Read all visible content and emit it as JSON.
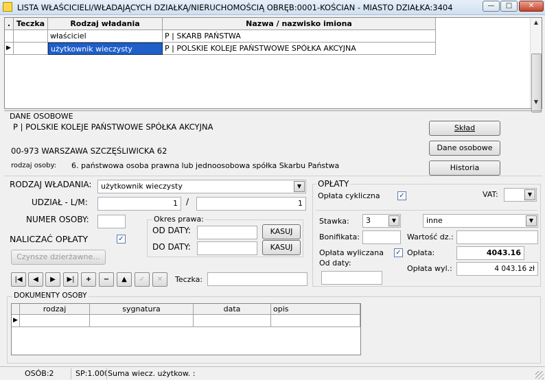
{
  "window": {
    "title": "LISTA WŁAŚCICIELI/WŁADAJĄCYCH DZIAŁKĄ/NIERUCHOMOŚCIĄ OBRĘB:0001-KOŚCIAN - MIASTO DZIAŁKA:3404",
    "minimize": "—",
    "maximize": "□",
    "close": "✕"
  },
  "owners_grid": {
    "headers": [
      ".",
      "Teczka",
      "Rodzaj władania",
      "Nazwa / nazwisko imiona"
    ],
    "rows": [
      {
        "indicator": "",
        "teczka": "",
        "rodzaj": "właściciel",
        "nazwa": "P | SKARB PAŃSTWA"
      },
      {
        "indicator": "▶",
        "teczka": "",
        "rodzaj": "użytkownik wieczysty",
        "nazwa": "P | POLSKIE KOLEJE PAŃSTWOWE SPÓŁKA AKCYJNA"
      }
    ]
  },
  "personal": {
    "section_title": "DANE OSOBOWE",
    "name": "P | POLSKIE KOLEJE PAŃSTWOWE SPÓŁKA AKCYJNA",
    "address": "00-973 WARSZAWA SZCZĘŚLIWICKA 62",
    "person_type_label": "rodzaj osoby:",
    "person_type_value": "6. państwowa osoba prawna lub jednoosobowa spółka Skarbu Państwa",
    "btn_sklad": "Skład",
    "btn_dane": "Dane osobowe",
    "btn_historia": "Historia"
  },
  "form": {
    "rodzaj_label": "RODZAJ WŁADANIA:",
    "rodzaj_value": "użytkownik wieczysty",
    "udzial_label": "UDZIAŁ -  L/M:",
    "udzial_l": "1",
    "udzial_sep": "/",
    "udzial_m": "1",
    "numer_label": "NUMER OSOBY:",
    "numer_value": "",
    "naliczac_label": "NALICZAĆ OPŁATY",
    "naliczac_checked": "✓",
    "czynsze_button": "Czynsze dzierżawne...",
    "okres_title": "Okres prawa:",
    "od_label": "OD DATY:",
    "do_label": "DO DATY:",
    "od_value": "",
    "do_value": "",
    "kasuj1": "KASUJ",
    "kasuj2": "KASUJ",
    "teczka_label": "Teczka:",
    "teczka_value": ""
  },
  "nav": {
    "first": "|◀",
    "prev": "◀",
    "next": "▶",
    "last": "▶|",
    "add": "+",
    "delete": "−",
    "up": "▲",
    "confirm": "✓",
    "cancel": "✕"
  },
  "oplaty": {
    "title": "OPŁATY",
    "cykliczna_label": "Opłata cykliczna",
    "cykliczna_checked": "✓",
    "vat_label": "VAT:",
    "vat_value": "",
    "stawka_label": "Stawka:",
    "stawka_value": "3",
    "inne_value": "inne",
    "bonifikata_label": "Bonifikata:",
    "bonifikata_value": "",
    "wartosc_label": "Wartość dz.:",
    "wartosc_value": "",
    "wyliczana_label": "Opłata wyliczana",
    "wyliczana_checked": "✓",
    "od_daty_label": "Od daty:",
    "od_daty_value": "",
    "oplata_label": "Opłata:",
    "oplata_value": "4043.16",
    "oplata_wyl_label": "Opłata wyl.:",
    "oplata_wyl_value": "4 043.16 zł"
  },
  "documents": {
    "title": "DOKUMENTY OSOBY",
    "headers": [
      "rodzaj",
      "sygnatura",
      "data",
      "opis"
    ],
    "row_indicator": "▶"
  },
  "status": {
    "osob": "OSÓB:2",
    "sp": "SP:1.000(",
    "suma": "Suma wiecz. użytkow. :"
  },
  "icons": {
    "app": "app-icon",
    "dropdown": "▼",
    "scroll_up": "▲",
    "scroll_down": "▼"
  }
}
